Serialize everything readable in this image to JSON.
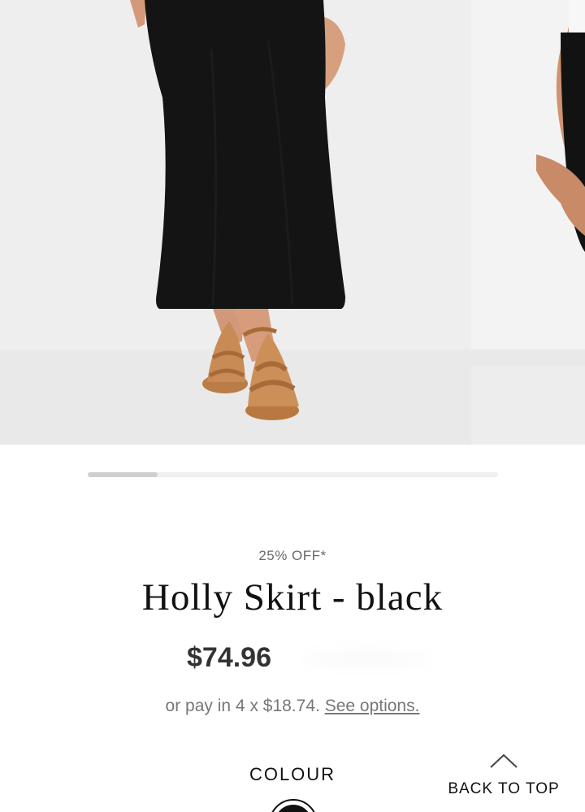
{
  "product": {
    "discount_label": "25% OFF*",
    "title": "Holly Skirt - black",
    "price": "$74.96",
    "installments_prefix": "or pay in 4 x $18.74.",
    "installments_link": "See options."
  },
  "carousel": {
    "progress": 0.17
  },
  "colour": {
    "label": "COLOUR",
    "selected": "black"
  },
  "back_to_top": {
    "label": "BACK TO TOP"
  },
  "colors": {
    "skirt": "#111111",
    "sandal": "#c58a52",
    "skin": "#d9a07d"
  }
}
